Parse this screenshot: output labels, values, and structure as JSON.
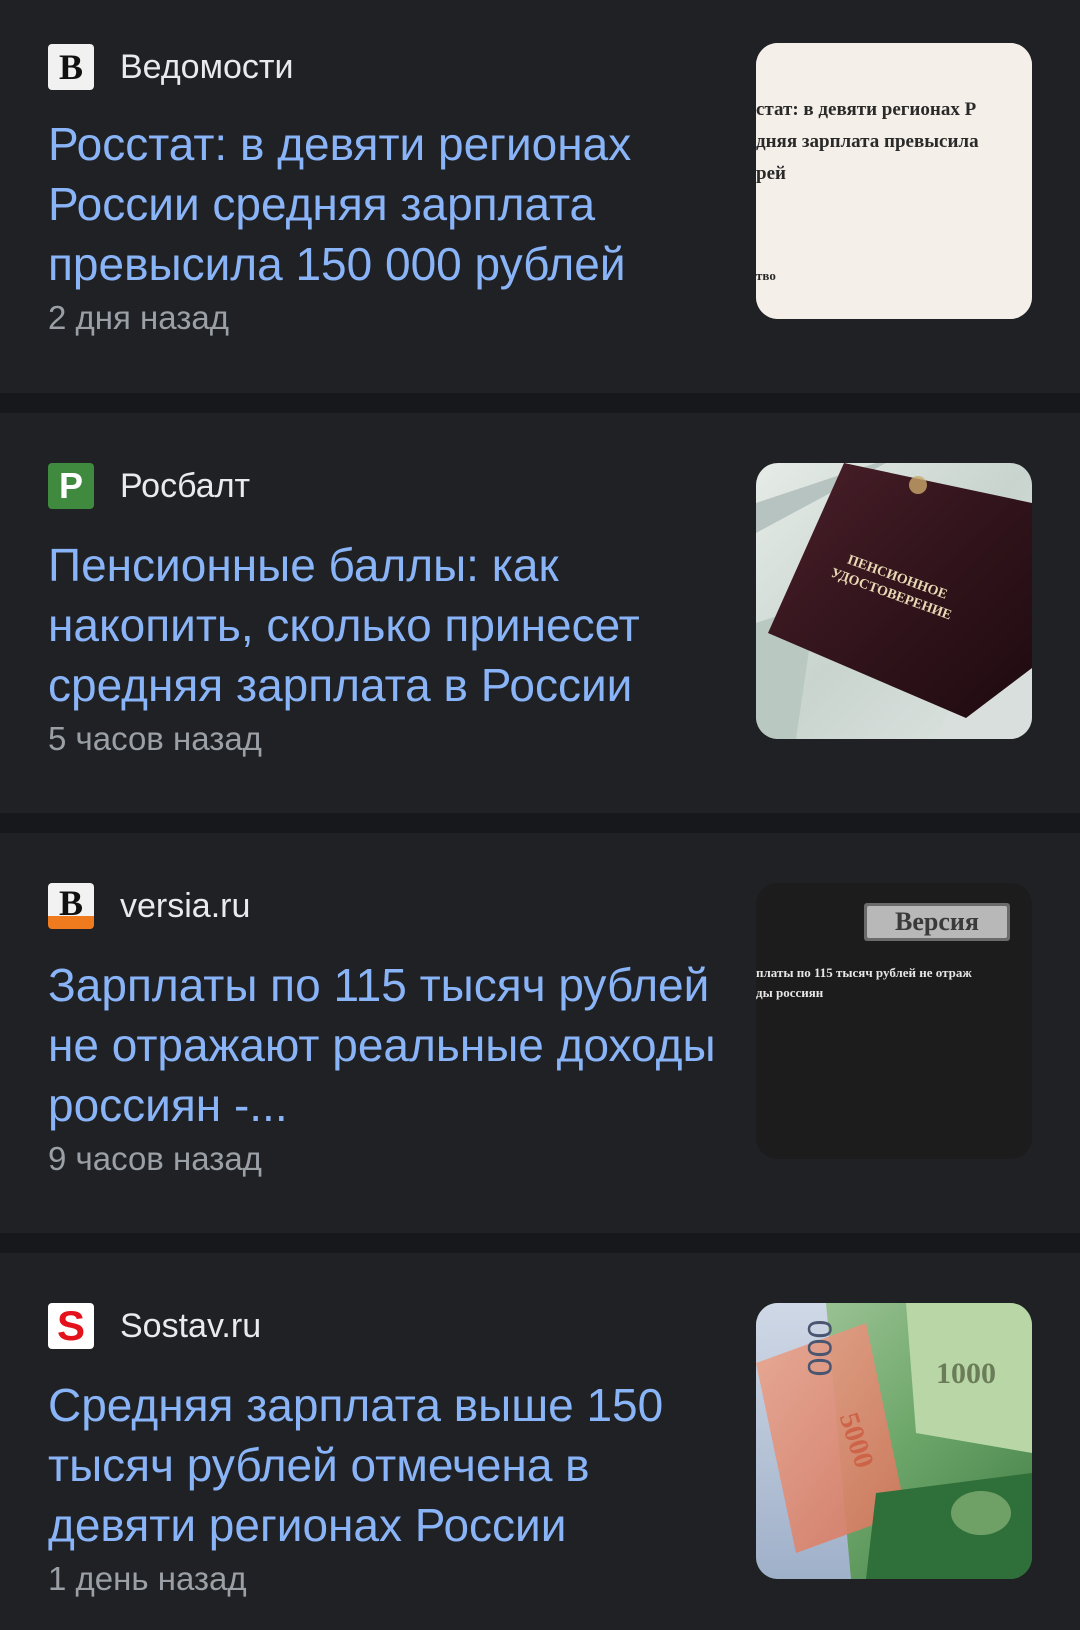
{
  "articles": [
    {
      "source": "Ведомости",
      "favicon_letter": "B",
      "headline": "Росстат: в девяти регионах России средняя зарплата превысила 150 000 рублей",
      "time": "2 дня назад",
      "thumbnail": {
        "line1": "стат: в девяти регионах Р",
        "line2": "дняя зарплата превысила",
        "line3": "рей",
        "line4": "тво"
      }
    },
    {
      "source": "Росбалт",
      "favicon_letter": "P",
      "headline": "Пенсионные баллы: как накопить, сколько принесет средняя зарплата в России",
      "time": "5 часов назад",
      "thumbnail": {
        "line1": "ПЕНСИОННОЕ",
        "line2": "УДОСТОВЕРЕНИЕ"
      }
    },
    {
      "source": "versia.ru",
      "favicon_letter": "B",
      "headline": "Зарплаты по 115 тысяч рублей не отражают реальные доходы россиян -...",
      "time": "9 часов назад",
      "thumbnail": {
        "brand": "Версия",
        "line1": "платы по 115 тысяч рублей не отраж",
        "line2": "ды россиян"
      }
    },
    {
      "source": "Sostav.ru",
      "favicon_letter": "S",
      "headline": "Средняя зарплата выше 150 тысяч рублей отмечена в девяти регионах России",
      "time": "1 день назад",
      "thumbnail": {
        "note1": "1000",
        "note2": "5000",
        "note3": "000"
      }
    }
  ],
  "colors": {
    "background": "#17181b",
    "card": "#202124",
    "headline": "#8ab4f8",
    "source": "#e8eaed",
    "time": "#9aa0a6"
  }
}
